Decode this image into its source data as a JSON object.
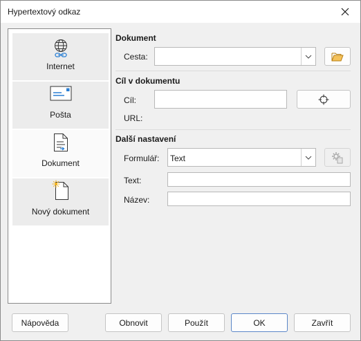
{
  "window": {
    "title": "Hypertextový odkaz"
  },
  "sidebar": {
    "items": [
      {
        "label": "Internet",
        "icon": "globe-link-icon"
      },
      {
        "label": "Pošta",
        "icon": "envelope-icon"
      },
      {
        "label": "Dokument",
        "icon": "document-icon",
        "selected": true
      },
      {
        "label": "Nový dokument",
        "icon": "new-document-icon"
      }
    ]
  },
  "document": {
    "section": "Dokument",
    "path_label": "Cesta:",
    "path_value": ""
  },
  "target": {
    "section": "Cíl v dokumentu",
    "target_label": "Cíl:",
    "target_value": "",
    "url_label": "URL:",
    "url_value": ""
  },
  "further": {
    "section": "Další nastavení",
    "form_label": "Formulář:",
    "form_value": "Text",
    "text_label": "Text:",
    "text_value": "",
    "name_label": "Název:",
    "name_value": ""
  },
  "buttons": {
    "help": "Nápověda",
    "reset": "Obnovit",
    "apply": "Použít",
    "ok": "OK",
    "cancel": "Zavřít"
  }
}
